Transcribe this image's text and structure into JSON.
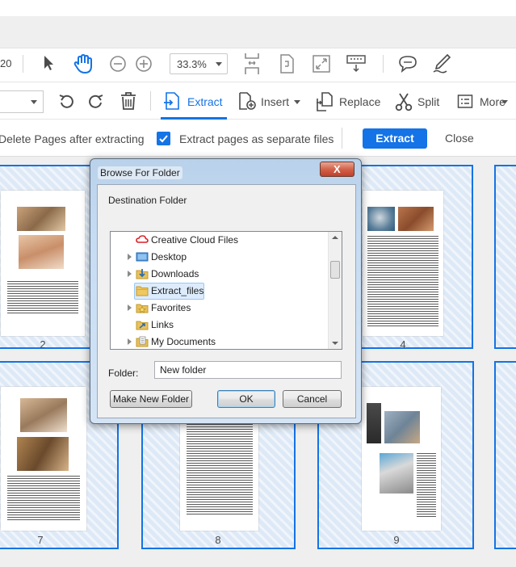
{
  "toolbar_top": {
    "page_number_fragment": "20",
    "zoom": "33.3%",
    "tools": [
      "select-tool",
      "hand-tool",
      "zoom-out",
      "zoom-in",
      "page-fit",
      "rotate-view",
      "full-screen",
      "keyboard",
      "comment",
      "sign"
    ]
  },
  "toolbar_organize": {
    "tools": {
      "extract": "Extract",
      "insert": "Insert",
      "replace": "Replace",
      "split": "Split",
      "more": "More"
    }
  },
  "extract_options": {
    "delete_pages": "Delete Pages after extracting",
    "separate_files": "Extract pages as separate files",
    "separate_files_checked": true,
    "extract_button": "Extract",
    "close_button": "Close"
  },
  "pages": {
    "numbers": [
      "2",
      "4",
      "7",
      "8",
      "9"
    ]
  },
  "dialog": {
    "title": "Browse For Folder",
    "close_symbol": "X",
    "destination_label": "Destination Folder",
    "tree": [
      {
        "label": "Creative Cloud Files",
        "icon": "creative-cloud-icon",
        "expandable": false
      },
      {
        "label": "Desktop",
        "icon": "desktop-folder-icon",
        "expandable": true
      },
      {
        "label": "Downloads",
        "icon": "downloads-folder-icon",
        "expandable": true
      },
      {
        "label": "Extract_files",
        "icon": "folder-icon",
        "expandable": false,
        "selected": true
      },
      {
        "label": "Favorites",
        "icon": "favorites-folder-icon",
        "expandable": true
      },
      {
        "label": "Links",
        "icon": "links-folder-icon",
        "expandable": false
      },
      {
        "label": "My Documents",
        "icon": "documents-folder-icon",
        "expandable": true
      }
    ],
    "folder_label": "Folder:",
    "folder_value": "New folder",
    "buttons": {
      "make_new_folder": "Make New Folder",
      "ok": "OK",
      "cancel": "Cancel"
    }
  },
  "colors": {
    "accent": "#1473e6",
    "selection_fill": "#dde9f6"
  }
}
